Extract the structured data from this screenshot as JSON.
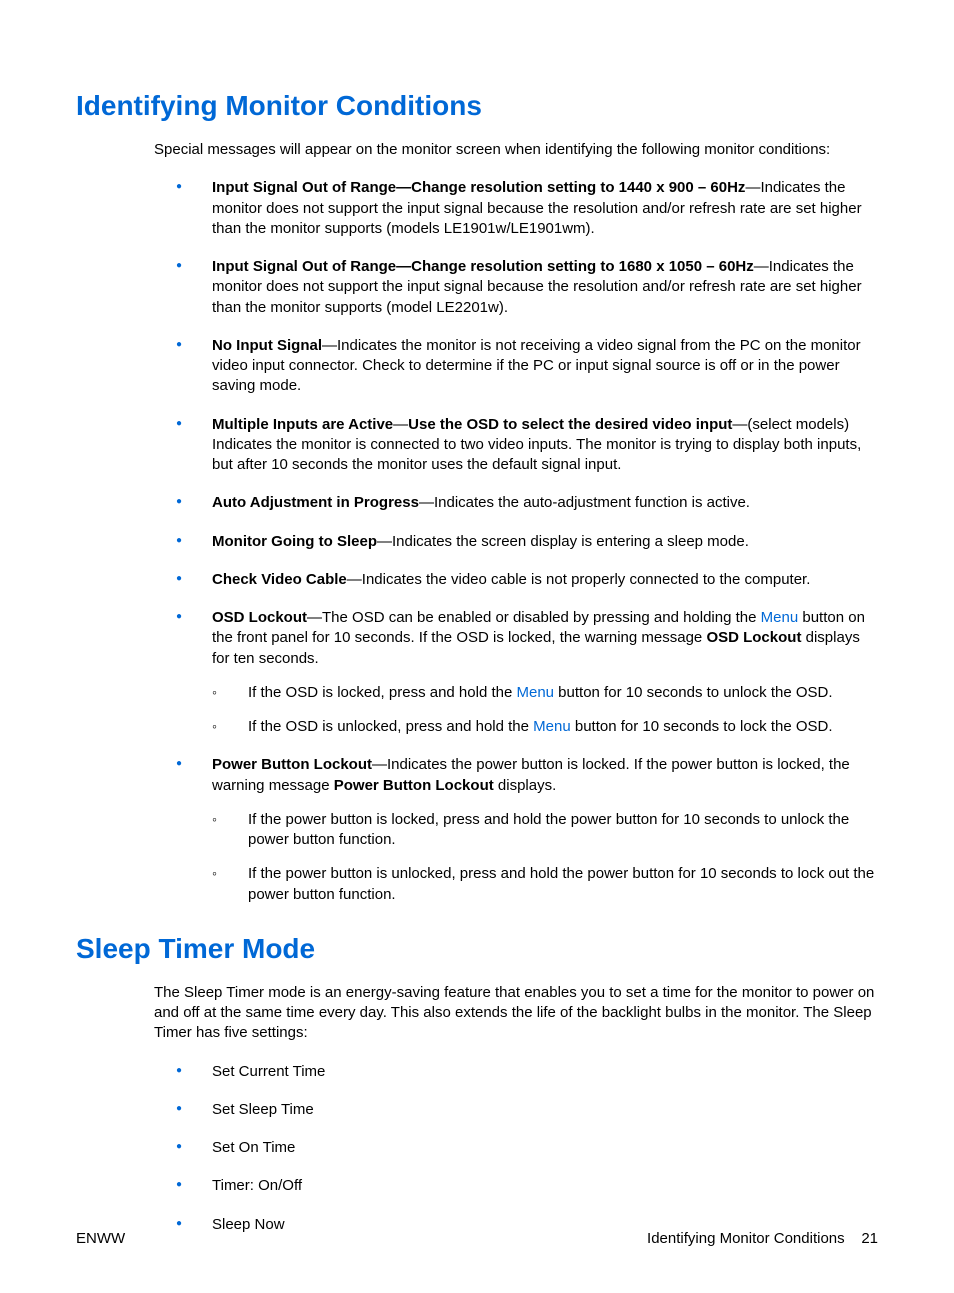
{
  "section1": {
    "title": "Identifying Monitor Conditions",
    "intro": "Special messages will appear on the monitor screen when identifying the following monitor conditions:",
    "items": {
      "i0": {
        "b": "Input Signal Out of Range—Change resolution setting to 1440 x 900 – 60Hz",
        "t": "—Indicates the monitor does not support the input signal because the resolution and/or refresh rate are set higher than the monitor supports (models LE1901w/LE1901wm)."
      },
      "i1": {
        "b": "Input Signal Out of Range—Change resolution setting to 1680 x 1050 – 60Hz",
        "t": "—Indicates the monitor does not support the input signal because the resolution and/or refresh rate are set higher than the monitor supports (model LE2201w)."
      },
      "i2": {
        "b": "No Input Signal",
        "t": "—Indicates the monitor is not receiving a video signal from the PC on the monitor video input connector. Check to determine if the PC or input signal source is off or in the power saving mode."
      },
      "i3": {
        "b1": "Multiple Inputs are Active",
        "dash": "—",
        "b2": "Use the OSD to select the desired video input",
        "t": "—(select models) Indicates the monitor is connected to two video inputs. The monitor is trying to display both inputs, but after 10 seconds the monitor uses the default signal input."
      },
      "i4": {
        "b": "Auto Adjustment in Progress",
        "t": "—Indicates the auto-adjustment function is active."
      },
      "i5": {
        "b": "Monitor Going to Sleep",
        "t": "—Indicates the screen display is entering a sleep mode."
      },
      "i6": {
        "b": "Check Video Cable",
        "t": "—Indicates the video cable is not properly connected to the computer."
      },
      "i7": {
        "b": "OSD Lockout",
        "t1": "—The OSD can be enabled or disabled by pressing and holding the ",
        "link": "Menu",
        "t2": " button on the front panel for 10 seconds. If the OSD is locked, the warning message ",
        "b2": "OSD Lockout",
        "t3": " displays for ten seconds.",
        "sub": {
          "s0": {
            "t1": "If the OSD is locked, press and hold the ",
            "link": "Menu",
            "t2": " button for 10 seconds to unlock the OSD."
          },
          "s1": {
            "t1": "If the OSD is unlocked, press and hold the ",
            "link": "Menu",
            "t2": " button for 10 seconds to lock the OSD."
          }
        }
      },
      "i8": {
        "b": "Power Button Lockout",
        "t1": "—Indicates the power button is locked. If the power button is locked, the warning message ",
        "b2": "Power Button Lockout",
        "t2": " displays.",
        "sub": {
          "s0": "If the power button is locked, press and hold the power button for 10 seconds to unlock the power button function.",
          "s1": "If the power button is unlocked, press and hold the power button for 10 seconds to lock out the power button function."
        }
      }
    }
  },
  "section2": {
    "title": "Sleep Timer Mode",
    "intro": "The Sleep Timer mode is an energy-saving feature that enables you to set a time for the monitor to power on and off at the same time every day. This also extends the life of the backlight bulbs in the monitor. The Sleep Timer has five settings:",
    "items": {
      "i0": "Set Current Time",
      "i1": "Set Sleep Time",
      "i2": "Set On Time",
      "i3": "Timer: On/Off",
      "i4": "Sleep Now"
    }
  },
  "footer": {
    "left": "ENWW",
    "right_label": "Identifying Monitor Conditions",
    "page": "21"
  }
}
